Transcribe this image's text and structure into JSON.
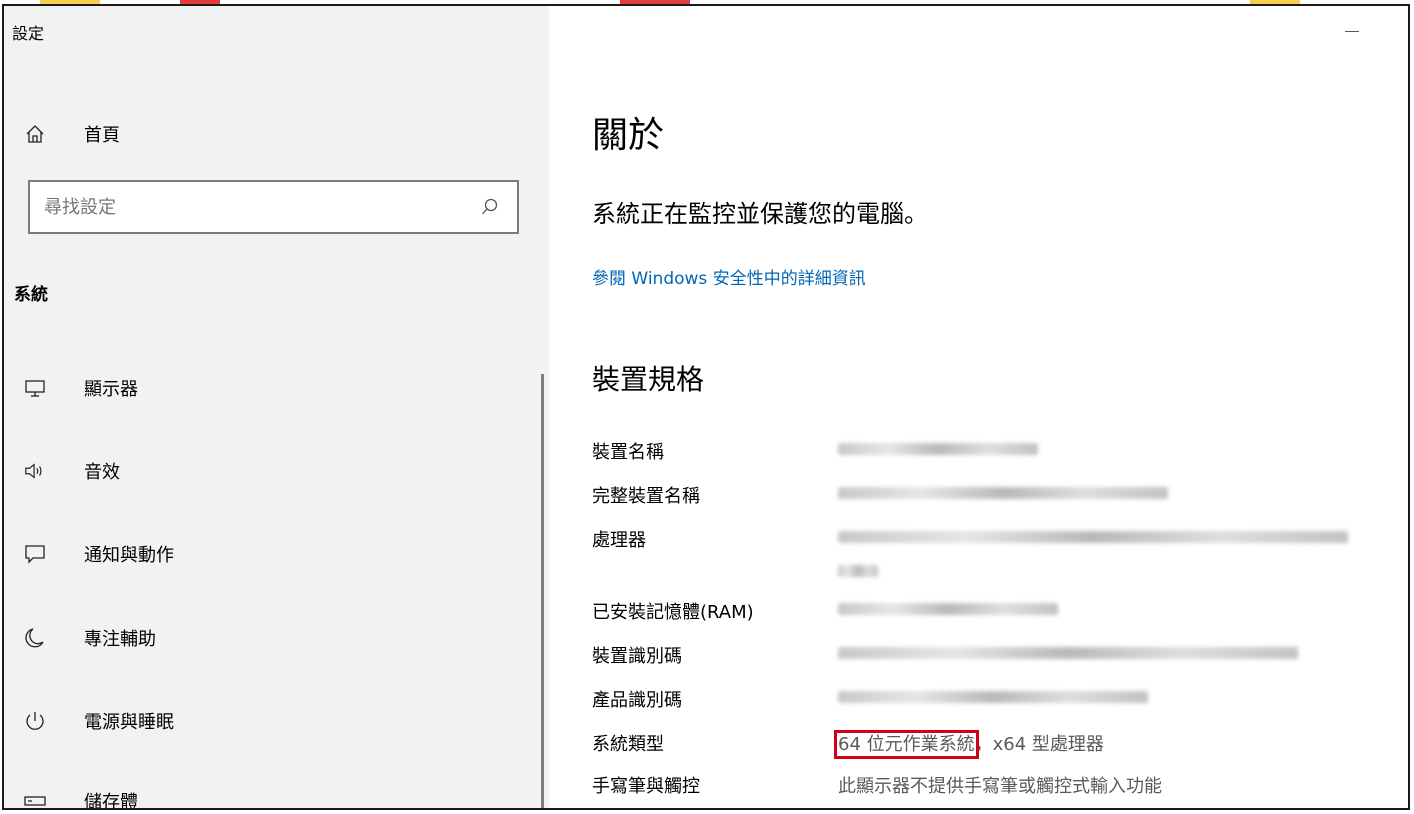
{
  "window": {
    "title": "設定",
    "colors": {
      "sidebar_bg": "#f2f2f2",
      "link": "#0067b8",
      "highlight_box": "#d0021b"
    }
  },
  "sidebar": {
    "home": {
      "label": "首頁",
      "icon": "home-icon"
    },
    "search": {
      "placeholder": "尋找設定",
      "icon": "search-icon"
    },
    "section_title": "系統",
    "items": [
      {
        "id": "display",
        "label": "顯示器",
        "icon": "monitor-icon"
      },
      {
        "id": "sound",
        "label": "音效",
        "icon": "speaker-icon"
      },
      {
        "id": "notifications",
        "label": "通知與動作",
        "icon": "message-icon"
      },
      {
        "id": "focus",
        "label": "專注輔助",
        "icon": "moon-icon"
      },
      {
        "id": "power",
        "label": "電源與睡眠",
        "icon": "power-icon"
      },
      {
        "id": "storage",
        "label": "儲存體",
        "icon": "storage-icon"
      }
    ]
  },
  "main": {
    "title": "關於",
    "status": "系統正在監控並保護您的電腦。",
    "security_link": "參閱 Windows 安全性中的詳細資訊",
    "specs_title": "裝置規格",
    "specs": [
      {
        "label": "裝置名稱"
      },
      {
        "label": "完整裝置名稱"
      },
      {
        "label": "處理器"
      },
      {
        "label": "已安裝記憶體(RAM)"
      },
      {
        "label": "裝置識別碼"
      },
      {
        "label": "產品識別碼"
      },
      {
        "label": "系統類型",
        "value_part1": "64 位元作業系統",
        "value_part2": "，x64 型處理器"
      },
      {
        "label": "手寫筆與觸控",
        "value": "此顯示器不提供手寫筆或觸控式輸入功能"
      }
    ]
  }
}
